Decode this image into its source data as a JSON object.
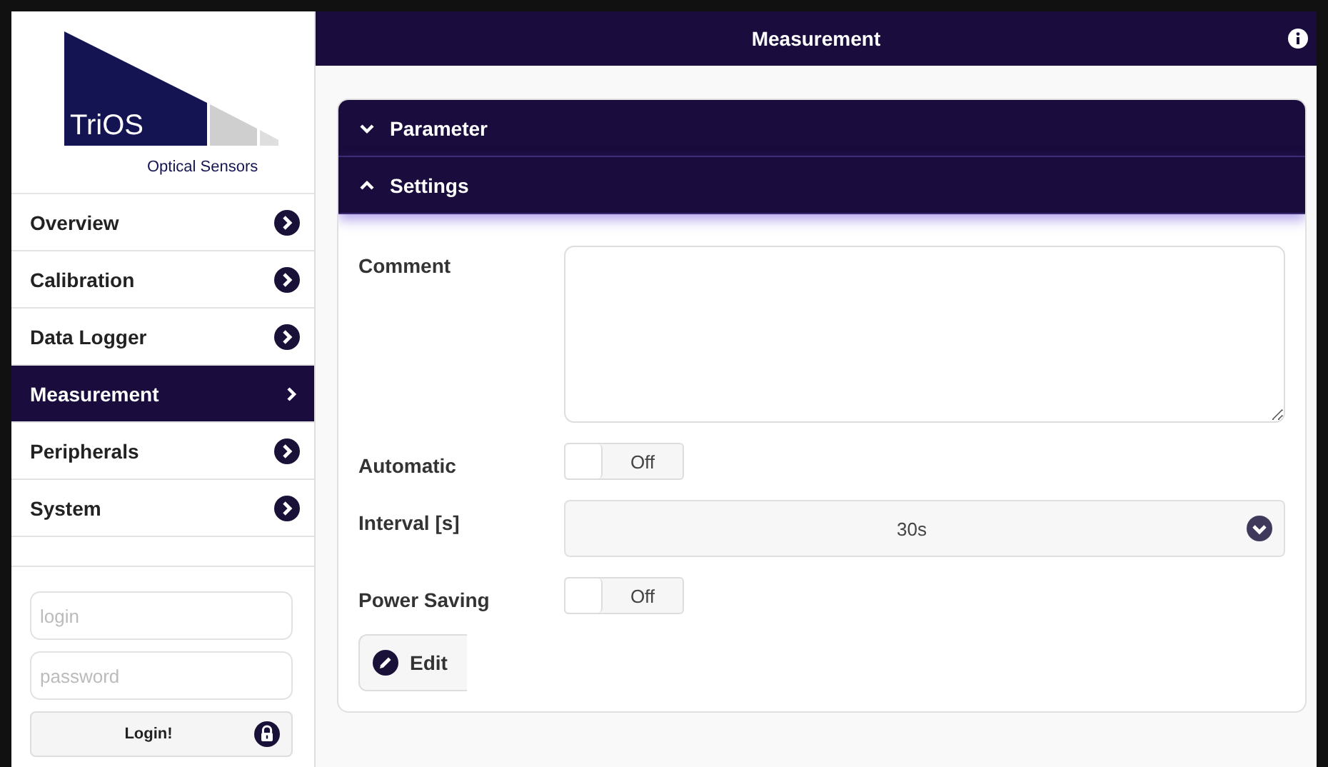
{
  "logo": {
    "name": "TriOS",
    "tagline": "Optical Sensors"
  },
  "nav": [
    {
      "label": "Overview",
      "selected": false
    },
    {
      "label": "Calibration",
      "selected": false
    },
    {
      "label": "Data Logger",
      "selected": false
    },
    {
      "label": "Measurement",
      "selected": true
    },
    {
      "label": "Peripherals",
      "selected": false
    },
    {
      "label": "System",
      "selected": false
    }
  ],
  "login": {
    "login_placeholder": "login",
    "password_placeholder": "password",
    "button": "Login!"
  },
  "header": {
    "title": "Measurement"
  },
  "sections": [
    {
      "title": "Parameter",
      "expanded": false
    },
    {
      "title": "Settings",
      "expanded": true
    }
  ],
  "fields": [
    {
      "kind": "textarea",
      "label": "Comment"
    },
    {
      "kind": "toggle",
      "label": "Automatic",
      "on": false,
      "state_text": "Off"
    },
    {
      "kind": "select",
      "label": "Interval [s]",
      "value": "30s"
    },
    {
      "kind": "toggle",
      "label": "Power Saving",
      "on": false,
      "state_text": "Off"
    }
  ],
  "edit_button": "Edit"
}
